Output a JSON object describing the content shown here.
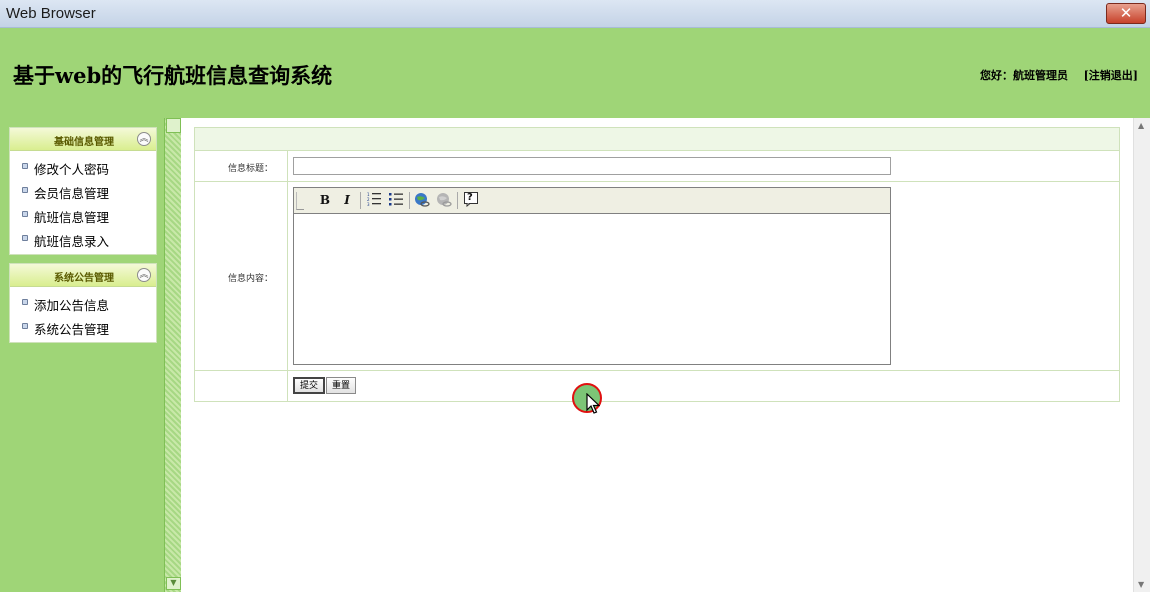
{
  "window": {
    "title": "Web Browser",
    "close_glyph": "✕"
  },
  "header": {
    "site_title": "基于web的飞行航班信息查询系统",
    "welcome": "您好：航班管理员",
    "logout": "[注销退出]"
  },
  "sidebar": {
    "groups": [
      {
        "title": "基础信息管理",
        "collapse_glyph": "︽",
        "items": [
          {
            "label": "修改个人密码"
          },
          {
            "label": "会员信息管理"
          },
          {
            "label": "航班信息管理"
          },
          {
            "label": "航班信息录入"
          }
        ]
      },
      {
        "title": "系统公告管理",
        "collapse_glyph": "︽",
        "items": [
          {
            "label": "添加公告信息"
          },
          {
            "label": "系统公告管理"
          }
        ]
      }
    ]
  },
  "form": {
    "title_label": "信息标题：",
    "title_value": "",
    "content_label": "信息内容：",
    "toolbar": {
      "bold": "B",
      "italic": "I",
      "ordered_list_icon": "ordered-list-icon",
      "unordered_list_icon": "unordered-list-icon",
      "link_icon": "link-icon",
      "unlink_icon": "unlink-icon",
      "help_icon": "help-icon",
      "help_glyph": "?"
    },
    "submit_label": "提交",
    "reset_label": "重置"
  },
  "scrollbar": {
    "up_glyph": "▲",
    "down_glyph": "▼"
  }
}
